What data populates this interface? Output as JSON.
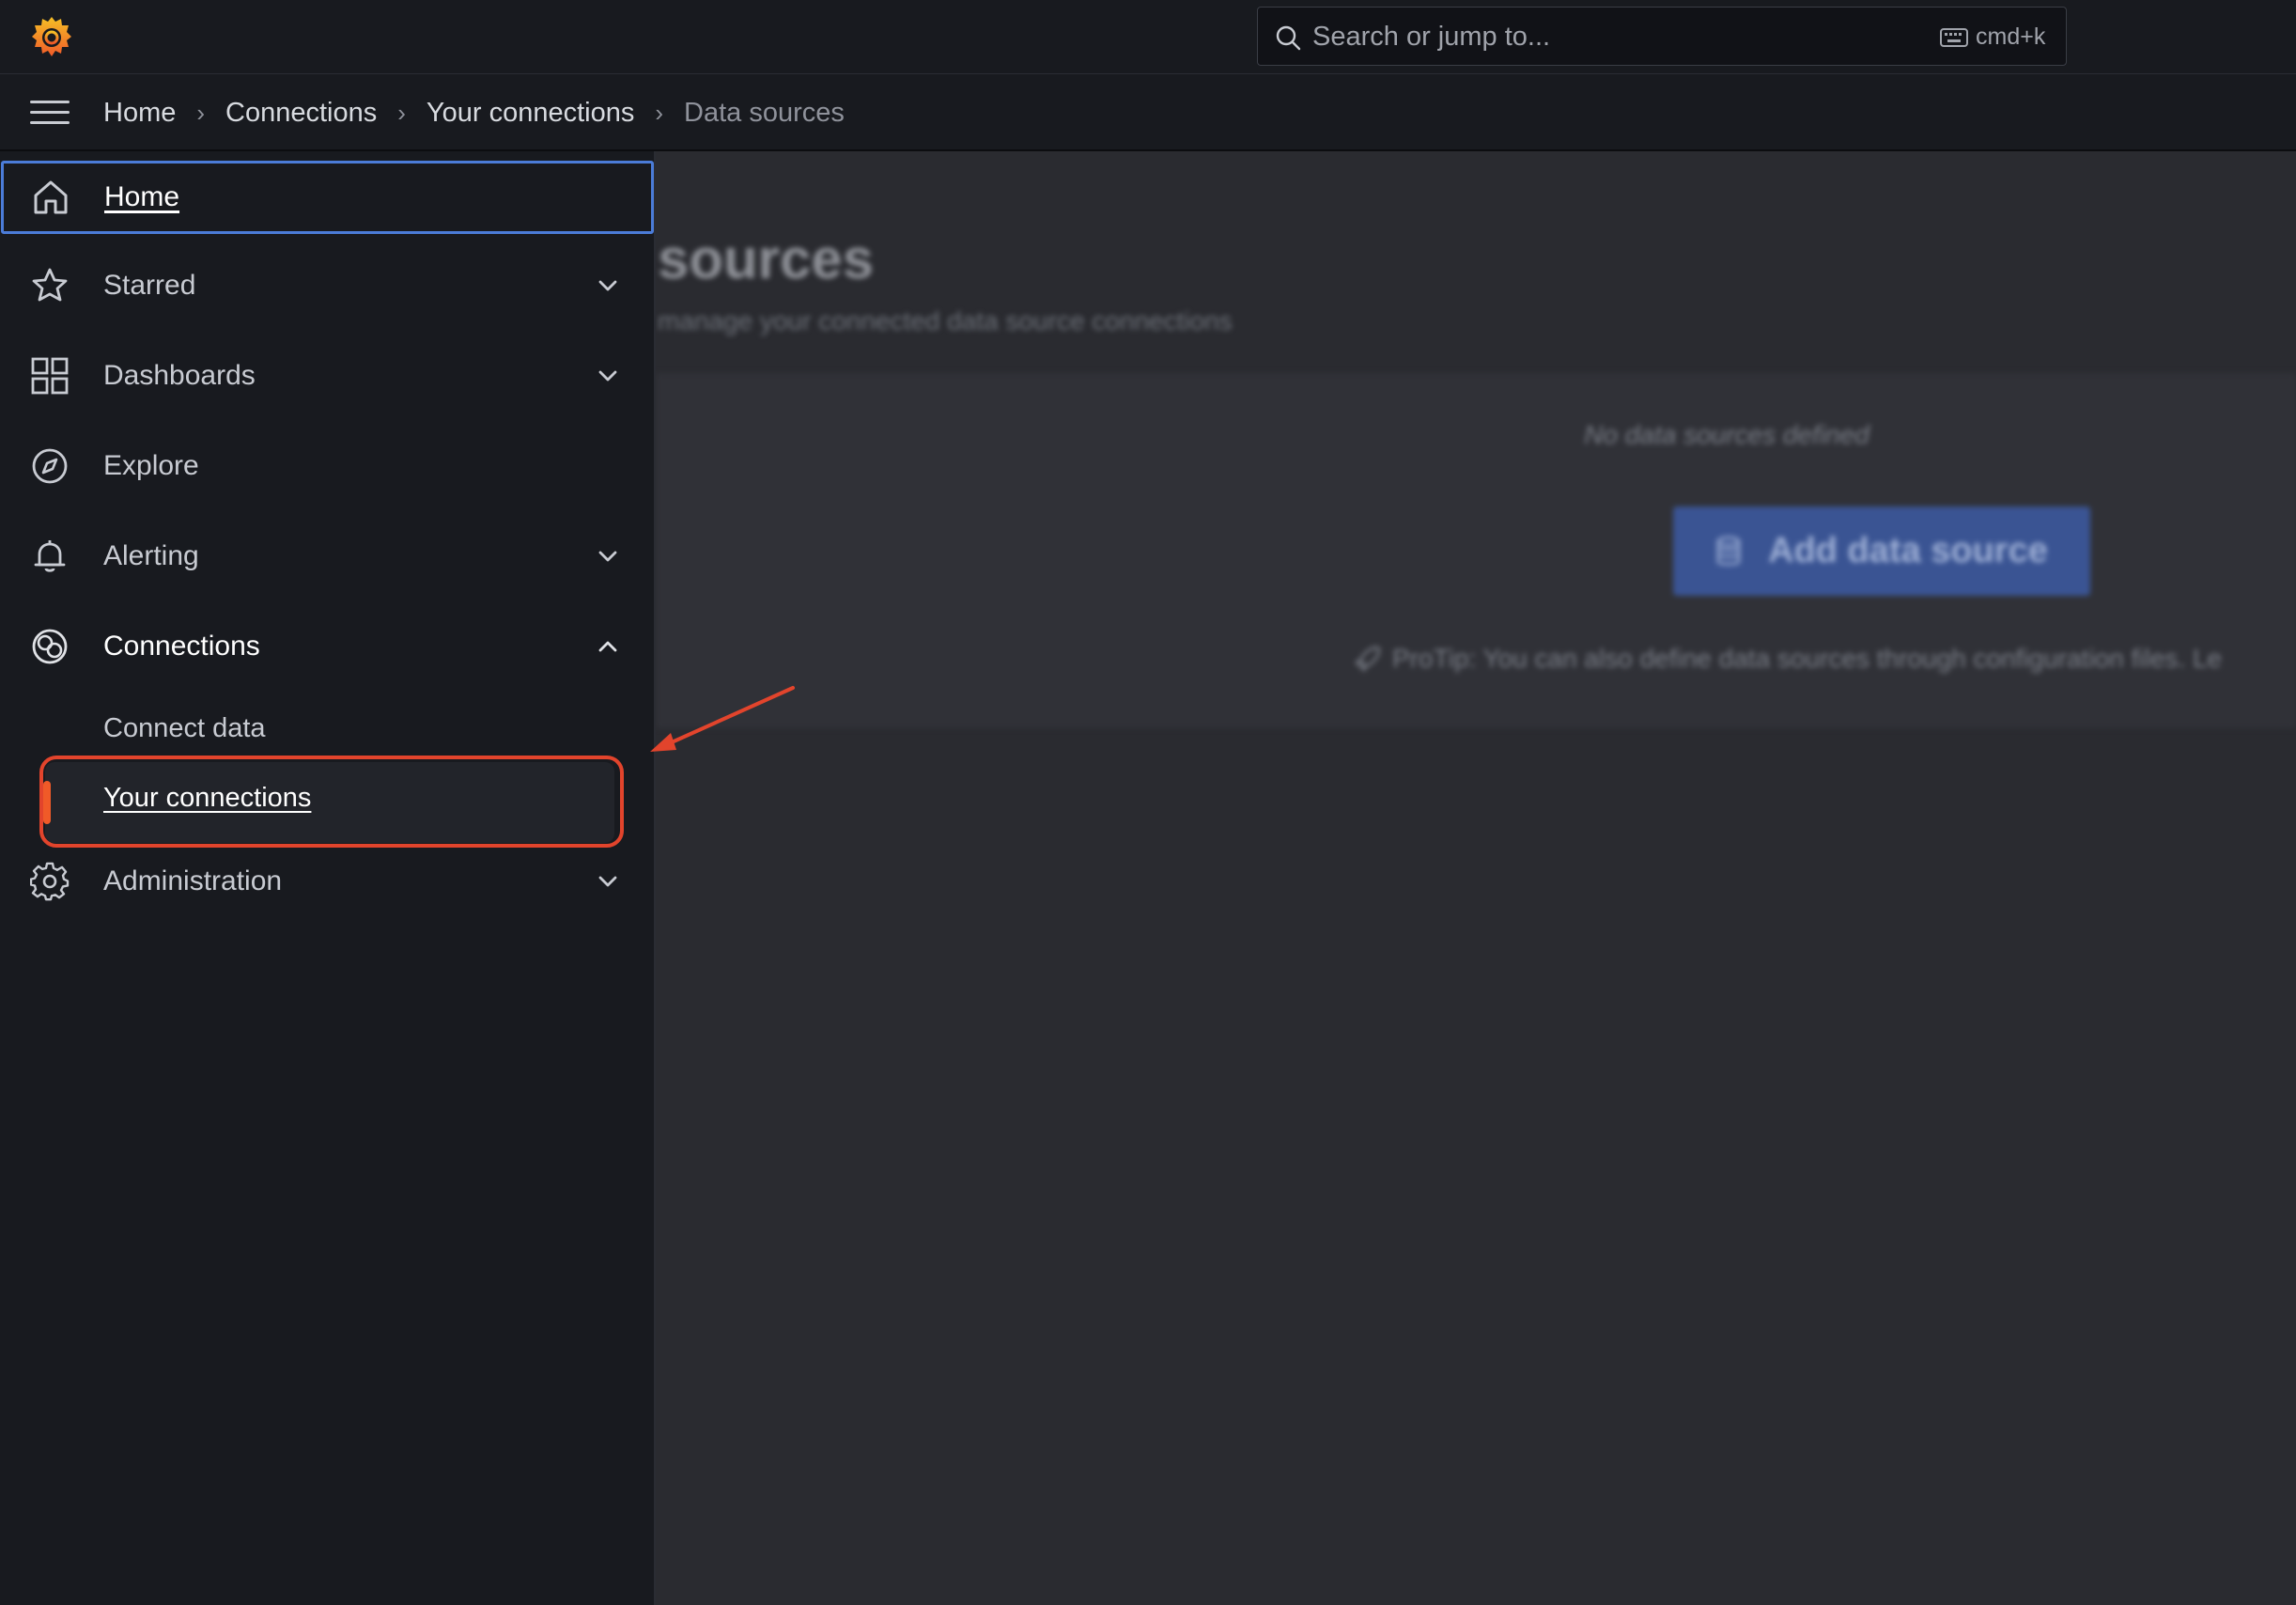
{
  "search": {
    "placeholder": "Search or jump to...",
    "shortcut": "cmd+k"
  },
  "breadcrumb": [
    "Home",
    "Connections",
    "Your connections",
    "Data sources"
  ],
  "sidebar": {
    "items": [
      {
        "label": "Home",
        "icon": "home-icon"
      },
      {
        "label": "Starred",
        "icon": "star-icon"
      },
      {
        "label": "Dashboards",
        "icon": "grid-icon"
      },
      {
        "label": "Explore",
        "icon": "compass-icon"
      },
      {
        "label": "Alerting",
        "icon": "bell-icon"
      },
      {
        "label": "Connections",
        "icon": "connections-icon"
      },
      {
        "label": "Administration",
        "icon": "gear-icon"
      }
    ],
    "connections_sub": [
      "Connect data",
      "Your connections"
    ]
  },
  "main": {
    "title": "sources",
    "subtitle": "manage your connected data source connections",
    "empty_text": "No data sources defined",
    "add_button": "Add data source",
    "protip": "ProTip: You can also define data sources through configuration files. Le"
  },
  "colors": {
    "accent_blue": "#4b7cd8",
    "annotation_red": "#e2442c",
    "active_bar_orange": "#f05a28",
    "button_blue": "#3a5493"
  }
}
